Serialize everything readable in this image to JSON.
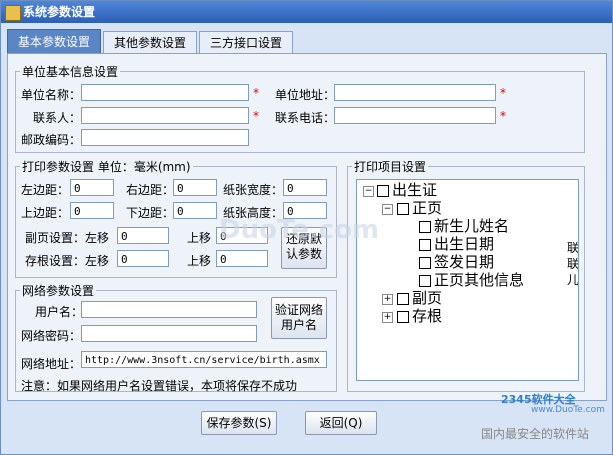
{
  "window": {
    "title": "系统参数设置"
  },
  "tabs": [
    {
      "label": "基本参数设置",
      "active": true
    },
    {
      "label": "其他参数设置",
      "active": false
    },
    {
      "label": "三方接口设置",
      "active": false
    }
  ],
  "unit_info": {
    "legend": "单位基本信息设置",
    "name_label": "单位名称：",
    "address_label": "单位地址：",
    "contact_label": "联系人：",
    "phone_label": "联系电话：",
    "zip_label": "邮政编码：",
    "required_mark": "*"
  },
  "print_params": {
    "legend": "打印参数设置 单位：毫米(mm)",
    "left_margin_label": "左边距：",
    "left_margin": "0",
    "right_margin_label": "右边距：",
    "right_margin": "0",
    "paper_width_label": "纸张宽度：",
    "paper_width": "0",
    "top_margin_label": "上边距：",
    "top_margin": "0",
    "bottom_margin_label": "下边距：",
    "bottom_margin": "0",
    "paper_height_label": "纸张高度：",
    "paper_height": "0",
    "sub_page_label": "副页设置：左移",
    "sub_page_left": "0",
    "sub_page_up_label": "上移",
    "sub_page_up": "0",
    "stub_label": "存根设置：左移",
    "stub_left": "0",
    "stub_up_label": "上移",
    "stub_up": "0",
    "restore_button": "还原默认参数"
  },
  "network": {
    "legend": "网络参数设置",
    "username_label": "用户名：",
    "password_label": "网络密码：",
    "address_label": "网络地址：",
    "address_value": "http://www.3nsoft.cn/service/birth.asmx",
    "verify_button": "验证网络用户名",
    "note": "注意：如果网络用户名设置错误，本项将保存不成功"
  },
  "print_items": {
    "legend": "打印项目设置",
    "tree": {
      "root": "出生证",
      "main_page": "正页",
      "item1": "新生儿姓名",
      "item2": "出生日期",
      "item3": "签发日期",
      "item4": "正页其他信息",
      "sub_page": "副页",
      "stub": "存根"
    },
    "clipped_right_text": "联\n联\n儿"
  },
  "buttons": {
    "save": "保存参数(S)",
    "back": "返回(Q)"
  },
  "watermark": {
    "center": "DuoTe.com",
    "corner_brand": "2345软件大全",
    "corner_site": "www.DuoTe.com",
    "footer": "国内最安全的软件站"
  }
}
